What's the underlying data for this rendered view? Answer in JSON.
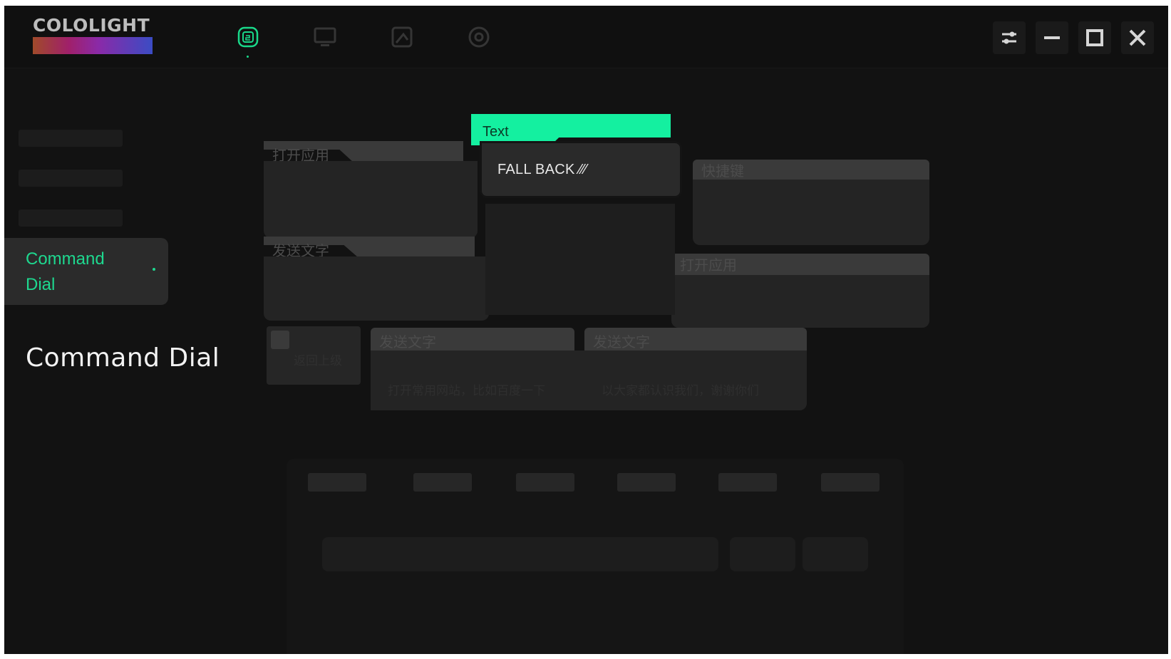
{
  "app": {
    "logo_text": "COLOLIGHT",
    "accent_color": "#1ed88f"
  },
  "topbar": {
    "nav": [
      {
        "icon": "command-dial-icon",
        "active": true
      },
      {
        "icon": "monitor-icon",
        "active": false
      },
      {
        "icon": "screen-capture-icon",
        "active": false
      },
      {
        "icon": "settings-icon",
        "active": false
      }
    ],
    "window_controls": [
      "settings-sliders-icon",
      "minimize-icon",
      "maximize-icon",
      "close-icon"
    ]
  },
  "sidebar": {
    "active_item": "Command Dial"
  },
  "page": {
    "heading": "Command Dial"
  },
  "dial": {
    "highlighted": {
      "tab_label": "Text",
      "fallback_text": "FALL BACK ⁄⁄⁄"
    },
    "cards": [
      {
        "tab": "打开应用"
      },
      {
        "tab": "发送文字"
      },
      {
        "tab": "快捷键"
      },
      {
        "tab": "打开应用"
      },
      {
        "tab": "发送文字",
        "desc": "打开常用网站，比如百度一下"
      },
      {
        "tab": "发送文字",
        "desc": "以大家都认识我们，谢谢你们"
      }
    ],
    "small_card_label": "返回上级"
  }
}
